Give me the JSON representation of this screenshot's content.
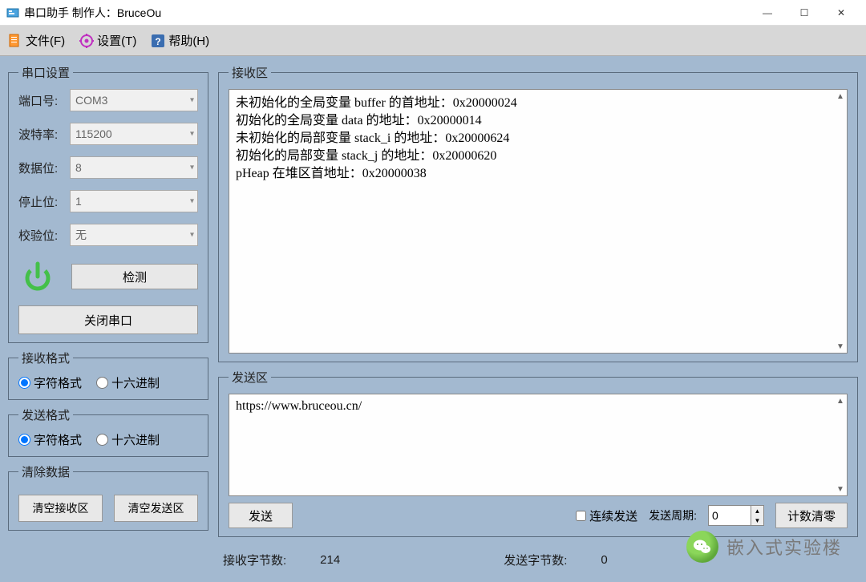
{
  "window": {
    "title": "串口助手 制作人：BruceOu",
    "min": "—",
    "max": "☐",
    "close": "✕"
  },
  "menu": {
    "file": "文件(F)",
    "settings": "设置(T)",
    "help": "帮助(H)"
  },
  "serial": {
    "legend": "串口设置",
    "port_label": "端口号:",
    "port_value": "COM3",
    "baud_label": "波特率:",
    "baud_value": "115200",
    "data_label": "数据位:",
    "data_value": "8",
    "stop_label": "停止位:",
    "stop_value": "1",
    "parity_label": "校验位:",
    "parity_value": "无",
    "detect_btn": "检测",
    "close_btn": "关闭串口"
  },
  "recv_fmt": {
    "legend": "接收格式",
    "char": "字符格式",
    "hex": "十六进制"
  },
  "send_fmt": {
    "legend": "发送格式",
    "char": "字符格式",
    "hex": "十六进制"
  },
  "clear": {
    "legend": "清除数据",
    "clear_recv": "清空接收区",
    "clear_send": "清空发送区"
  },
  "recv_area": {
    "legend": "接收区",
    "text": "未初始化的全局变量 buffer 的首地址：0x20000024\n初始化的全局变量 data 的地址：0x20000014\n未初始化的局部变量 stack_i 的地址：0x20000624\n初始化的局部变量 stack_j 的地址：0x20000620\npHeap 在堆区首地址：0x20000038"
  },
  "send_area": {
    "legend": "发送区",
    "text": "https://www.bruceou.cn/",
    "send_btn": "发送",
    "cont_send": "连续发送",
    "period_label": "发送周期:",
    "period_value": "0",
    "reset_btn": "计数清零"
  },
  "status": {
    "recv_label": "接收字节数:",
    "recv_value": "214",
    "send_label": "发送字节数:",
    "send_value": "0"
  },
  "watermark": {
    "text": "嵌入式实验楼"
  }
}
